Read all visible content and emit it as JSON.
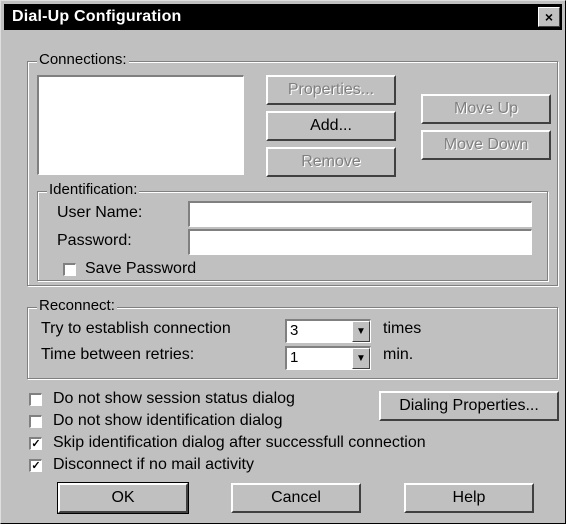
{
  "window": {
    "title": "Dial-Up Configuration",
    "close_glyph": "×"
  },
  "connections": {
    "legend": "Connections:",
    "properties_label": "Properties...",
    "add_label": "Add...",
    "remove_label": "Remove",
    "move_up_label": "Move Up",
    "move_down_label": "Move Down"
  },
  "identification": {
    "legend": "Identification:",
    "user_name_label": "User Name:",
    "user_name_value": "",
    "password_label": "Password:",
    "password_value": "",
    "save_password_label": "Save Password",
    "save_password_checked": false
  },
  "reconnect": {
    "legend": "Reconnect:",
    "try_label": "Try to establish connection",
    "try_value": "3",
    "try_unit": "times",
    "time_label": "Time between retries:",
    "time_value": "1",
    "time_unit": "min."
  },
  "options": [
    {
      "label": "Do not show session status dialog",
      "checked": false
    },
    {
      "label": "Do not show identification dialog",
      "checked": false
    },
    {
      "label": "Skip identification dialog after successfull connection",
      "checked": true
    },
    {
      "label": "Disconnect if no mail activity",
      "checked": true
    }
  ],
  "dialing_properties_label": "Dialing Properties...",
  "footer": {
    "ok_label": "OK",
    "cancel_label": "Cancel",
    "help_label": "Help"
  },
  "check_glyph": "✓"
}
